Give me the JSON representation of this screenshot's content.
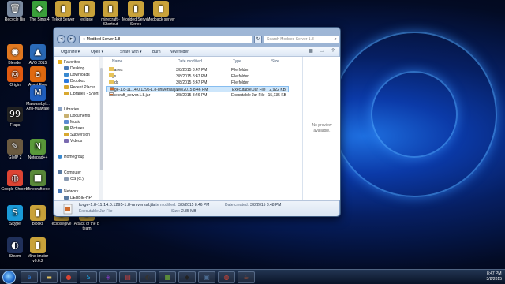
{
  "desktop": {
    "icons": [
      {
        "label": "Recycle Bin",
        "glyph": "🗑",
        "color": "#7a8aa0"
      },
      {
        "label": "The Sims 4",
        "glyph": "◆",
        "color": "#3aa03a"
      },
      {
        "label": "Tekkit Server",
        "glyph": "▮",
        "color": "#c9a23a"
      },
      {
        "label": "eclipse",
        "glyph": "▮",
        "color": "#c9a23a"
      },
      {
        "label": "minecraft - Shortcut",
        "glyph": "▮",
        "color": "#c9a23a"
      },
      {
        "label": "Modded Server Series",
        "glyph": "▮",
        "color": "#c9a23a"
      },
      {
        "label": "Modpack server",
        "glyph": "▮",
        "color": "#c9a23a"
      },
      {
        "label": "Blender",
        "glyph": "◉",
        "color": "#e07820"
      },
      {
        "label": "AVG 2015",
        "glyph": "▲",
        "color": "#2a6ab8"
      },
      {
        "label": "Avast Free Antivirus",
        "glyph": "a",
        "color": "#e06a10"
      },
      {
        "label": "Origin",
        "glyph": "◎",
        "color": "#e05a10"
      },
      {
        "label": "Malwarebyt... Anti-Malware",
        "glyph": "M",
        "color": "#2060c0"
      },
      {
        "label": "Fraps",
        "glyph": "99",
        "color": "#222"
      },
      {
        "label": "GIMP 2",
        "glyph": "✎",
        "color": "#6a5a40"
      },
      {
        "label": "Notepad++",
        "glyph": "N",
        "color": "#5a9a3a"
      },
      {
        "label": "Google Chrome",
        "glyph": "◍",
        "color": "#dd4433"
      },
      {
        "label": "Minecraft.exe",
        "glyph": "■",
        "color": "#5a8a3a"
      },
      {
        "label": "Skype",
        "glyph": "S",
        "color": "#1a9ad8"
      },
      {
        "label": "blocks",
        "glyph": "▮",
        "color": "#c9a23a"
      },
      {
        "label": "eclipsegive",
        "glyph": "▮",
        "color": "#c9a23a"
      },
      {
        "label": "Attack of the B team",
        "glyph": "▮",
        "color": "#c9a23a"
      },
      {
        "label": "Steam",
        "glyph": "◐",
        "color": "#20305a"
      },
      {
        "label": "Mine-imator v0.6.2",
        "glyph": "▮",
        "color": "#c9a23a"
      }
    ]
  },
  "window": {
    "address_path": "Modded Server 1.8",
    "search_placeholder": "Search Modded Server 1.8",
    "toolbar": {
      "organize": "Organize ▾",
      "open": "Open ▾",
      "share": "Share with ▾",
      "burn": "Burn",
      "new_folder": "New folder"
    },
    "nav": {
      "favorites": "Favorites",
      "desktop": "Desktop",
      "downloads": "Downloads",
      "dropbox": "Dropbox",
      "recent_places": "Recent Places",
      "libraries_shortcut": "Libraries - Shortcu",
      "libraries": "Libraries",
      "documents": "Documents",
      "music": "Music",
      "pictures": "Pictures",
      "subversion": "Subversion",
      "videos": "Videos",
      "homegroup": "Homegroup",
      "computer": "Computer",
      "os_c": "OS (C:)",
      "network": "Network",
      "debbie_hp": "DEBBIE-HP"
    },
    "columns": {
      "name": "Name",
      "date": "Date modified",
      "type": "Type",
      "size": "Size"
    },
    "files": [
      {
        "name": "libraries",
        "date": "3/8/2015 8:47 PM",
        "type": "File folder",
        "size": "",
        "kind": "folder"
      },
      {
        "name": "logs",
        "date": "3/8/2015 8:47 PM",
        "type": "File folder",
        "size": "",
        "kind": "folder"
      },
      {
        "name": "mods",
        "date": "3/8/2015 8:47 PM",
        "type": "File folder",
        "size": "",
        "kind": "folder"
      },
      {
        "name": "forge-1.8-11.14.0.1295-1.8-universal.jar",
        "date": "3/8/2015 8:46 PM",
        "type": "Executable Jar File",
        "size": "2,922 KB",
        "kind": "jar"
      },
      {
        "name": "minecraft_server.1.8.jar",
        "date": "3/8/2015 8:46 PM",
        "type": "Executable Jar File",
        "size": "15,135 KB",
        "kind": "jar"
      }
    ],
    "preview_text_1": "No preview",
    "preview_text_2": "available.",
    "details": {
      "filename": "forge-1.8-11.14.0.1295-1.8-universal.jar",
      "type": "Executable Jar File",
      "date_modified_label": "Date modified:",
      "date_modified": "3/8/2015 8:46 PM",
      "size_label": "Size:",
      "size": "2.85 MB",
      "date_created_label": "Date created:",
      "date_created": "3/8/2015 8:48 PM"
    }
  },
  "taskbar": {
    "buttons": [
      {
        "glyph": "e",
        "color": "#2a7ad8"
      },
      {
        "glyph": "▬",
        "color": "#e0c060"
      },
      {
        "glyph": "●",
        "color": "#d84433"
      },
      {
        "glyph": "S",
        "color": "#1a9ad8"
      },
      {
        "glyph": "◈",
        "color": "#7a3ab8"
      },
      {
        "glyph": "▤",
        "color": "#c04040"
      },
      {
        "glyph": "◐",
        "color": "#333"
      },
      {
        "glyph": "■",
        "color": "#5a8a3a"
      },
      {
        "glyph": "◆",
        "color": "#222"
      },
      {
        "glyph": "▣",
        "color": "#4a6a90"
      },
      {
        "glyph": "◍",
        "color": "#dd4433"
      },
      {
        "glyph": "☕",
        "color": "#b05030"
      }
    ],
    "clock_time": "8:47 PM",
    "clock_date": "3/8/2015"
  }
}
